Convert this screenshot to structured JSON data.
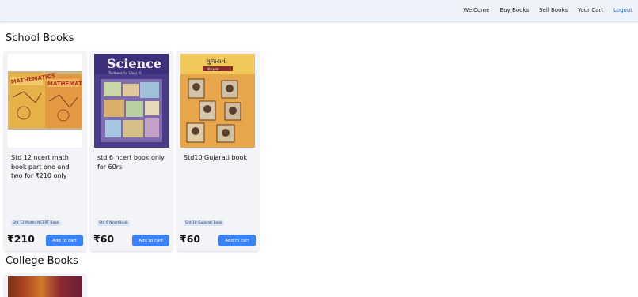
{
  "nav": {
    "items": [
      "WelCome",
      "Buy Books",
      "Sell Books",
      "Your Cart"
    ],
    "logout_label": "Logout"
  },
  "sections": {
    "school": {
      "title": "School Books",
      "books": [
        {
          "image": "math-books-photo",
          "cover_text": "MATHEMATICS",
          "title": "Std 12 ncert math book part one and two for ₹210 only",
          "tag": "Std 12 Maths NCERT Book",
          "price": "₹210",
          "button": "Add to cart"
        },
        {
          "image": "science-book-cover",
          "cover_text": "Science",
          "cover_subtext": "Textbook for Class VI",
          "title": "std 6 ncert book only for 60rs",
          "tag": "Std 6 NcertBook",
          "price": "₹60",
          "button": "Add to cart"
        },
        {
          "image": "gujarati-book-cover",
          "cover_text": "ગુજરાતી",
          "cover_subtext": "ધોરણ ૧૦",
          "title": "Std10 Gujarati book",
          "tag": "Std 10 Gujarati Book",
          "price": "₹60",
          "button": "Add to cart"
        }
      ]
    },
    "college": {
      "title": "College Books"
    }
  },
  "colors": {
    "accent": "#3b82f6",
    "logout": "#2e6ee0",
    "navbar_bg": "#eef3fb",
    "card_bg": "#f2f4f8"
  }
}
